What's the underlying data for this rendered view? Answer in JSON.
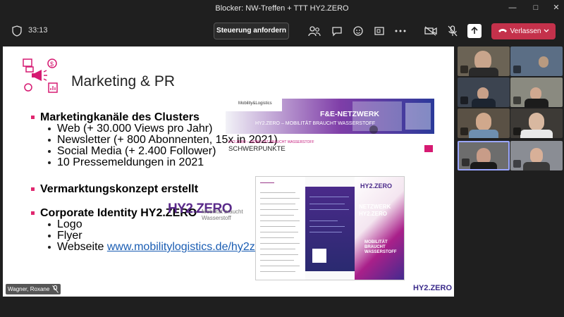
{
  "window": {
    "title": "Blocker: NW-Treffen + TTT HY2.ZERO"
  },
  "toolbar": {
    "timer": "33:13",
    "control_request_label": "Steuerung anfordern",
    "leave_label": "Verlassen"
  },
  "slide": {
    "title": "Marketing & PR",
    "section1": "Marketingkanäle des Clusters",
    "section1_items": [
      "Web (+ 30.000 Views pro Jahr)",
      "Newsletter (+ 800 Abonnenten, 15x in 2021)",
      "Social Media (+ 2.400 Follower)",
      "10 Pressemeldungen in 2021"
    ],
    "section2": "Vermarktungskonzept erstellt",
    "section3": "Corporate Identity HY2.ZERO",
    "section3_items": [
      "Logo",
      "Flyer"
    ],
    "website_prefix": "Webseite ",
    "website_link": "www.mobilitylogistics.de/hy2zero",
    "logo_main": "HY2.ZERO",
    "logo_sub1": "Mobilität braucht",
    "logo_sub2": "Wasserstoff",
    "banner_brand": "Mobility&Logistics",
    "banner_title": "F&E-NETZWERK",
    "banner_subtitle": "HY2.ZERO – MOBILITÄT BRAUCHT WASSERSTOFF",
    "banner_caption": "HY2.ZERO – MOBILITÄT BRAUCHT WASSERSTOFF",
    "banner_heading": "SCHWERPUNKTE",
    "brochure_title1": "NETZWERK",
    "brochure_title2": "HY2.ZERO",
    "brochure_claim1": "MOBILITÄT",
    "brochure_claim2": "BRAUCHT",
    "brochure_claim3": "WASSERSTOFF",
    "footer_logo": "HY2.ZERO"
  },
  "presenter": {
    "name": "Wagner, Roxane"
  },
  "colors": {
    "accent": "#e0276f",
    "leave": "#c4314b",
    "link": "#1a5db3"
  }
}
